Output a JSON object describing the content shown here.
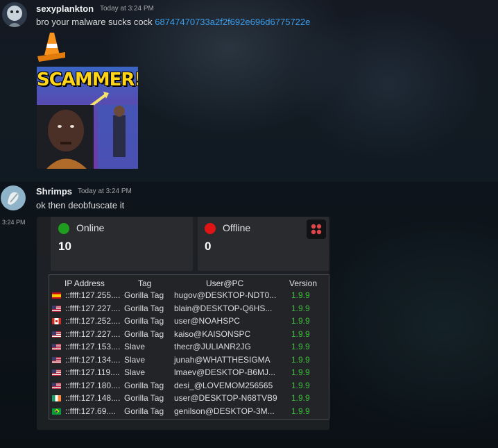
{
  "messages": [
    {
      "username": "sexyplankton",
      "timestamp": "Today at 3:24 PM",
      "text": "bro your malware sucks cock ",
      "link": "68747470733a2f2f692e696d6775722e",
      "thumbnail_text": "SCAMMER!"
    },
    {
      "username": "Shrimps",
      "timestamp": "Today at 3:24 PM",
      "text": "ok then deobfuscate it",
      "hover_time": "3:24 PM"
    }
  ],
  "embed": {
    "online": {
      "label": "Online",
      "count": "10",
      "color": "#1f9d1f"
    },
    "offline": {
      "label": "Offline",
      "count": "0",
      "color": "#e01414"
    },
    "table": {
      "headers": [
        "IP Address",
        "Tag",
        "User@PC",
        "Version"
      ],
      "rows": [
        {
          "flag": "es",
          "ip": "::ffff:127.255....",
          "tag": "Gorilla Tag",
          "user": "hugov@DESKTOP-NDT0...",
          "version": "1.9.9"
        },
        {
          "flag": "us",
          "ip": "::ffff:127.227....",
          "tag": "Gorilla Tag",
          "user": "blain@DESKTOP-Q6HS...",
          "version": "1.9.9"
        },
        {
          "flag": "ca",
          "ip": "::ffff:127.252....",
          "tag": "Gorilla Tag",
          "user": "user@NOAHSPC",
          "version": "1.9.9"
        },
        {
          "flag": "us",
          "ip": "::ffff:127.227....",
          "tag": "Gorilla Tag",
          "user": "kaiso@KAISONSPC",
          "version": "1.9.9"
        },
        {
          "flag": "us",
          "ip": "::ffff:127.153....",
          "tag": "Slave",
          "user": "thecr@JULIANR2JG",
          "version": "1.9.9"
        },
        {
          "flag": "us",
          "ip": "::ffff:127.134....",
          "tag": "Slave",
          "user": "junah@WHATTHESIGMA",
          "version": "1.9.9"
        },
        {
          "flag": "us",
          "ip": "::ffff:127.119....",
          "tag": "Slave",
          "user": "lmaev@DESKTOP-B6MJ...",
          "version": "1.9.9"
        },
        {
          "flag": "us",
          "ip": "::ffff:127.180....",
          "tag": "Gorilla Tag",
          "user": "desi_@LOVEMOM256565",
          "version": "1.9.9"
        },
        {
          "flag": "ie",
          "ip": "::ffff:127.148....",
          "tag": "Gorilla Tag",
          "user": "user@DESKTOP-N68TVB9",
          "version": "1.9.9"
        },
        {
          "flag": "br",
          "ip": "::ffff:127.69....",
          "tag": "Gorilla Tag",
          "user": "genilson@DESKTOP-3M...",
          "version": "1.9.9"
        }
      ]
    }
  },
  "icons": {
    "traffic_cone": "traffic-cone-icon",
    "app_icon": "rat-panel-icon"
  }
}
